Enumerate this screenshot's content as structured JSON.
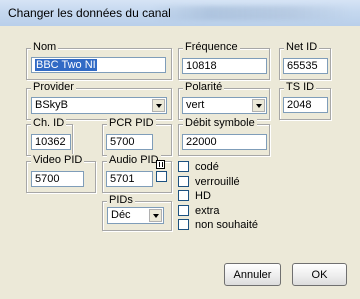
{
  "window": {
    "title": "Changer les données du canal"
  },
  "fields": {
    "nom": {
      "label": "Nom",
      "value": "BBC Two NI"
    },
    "frequence": {
      "label": "Fréquence",
      "value": "10818"
    },
    "net_id": {
      "label": "Net ID",
      "value": "65535"
    },
    "provider": {
      "label": "Provider",
      "value": "BSkyB"
    },
    "polarite": {
      "label": "Polarité",
      "value": "vert"
    },
    "ts_id": {
      "label": "TS ID",
      "value": "2048"
    },
    "ch_id": {
      "label": "Ch. ID",
      "value": "10362"
    },
    "pcr_pid": {
      "label": "PCR PID",
      "value": "5700"
    },
    "debit_symbole": {
      "label": "Débit symbole",
      "value": "22000"
    },
    "video_pid": {
      "label": "Video PID",
      "value": "5700"
    },
    "audio_pid": {
      "label": "Audio PID",
      "value": "5701"
    },
    "pids": {
      "label": "PIDs",
      "value": "Déc"
    }
  },
  "checkboxes": [
    {
      "label": "codé",
      "checked": false
    },
    {
      "label": "verrouillé",
      "checked": false
    },
    {
      "label": "HD",
      "checked": false
    },
    {
      "label": "extra",
      "checked": false
    },
    {
      "label": "non souhaité",
      "checked": false
    }
  ],
  "buttons": {
    "cancel": "Annuler",
    "ok": "OK"
  }
}
